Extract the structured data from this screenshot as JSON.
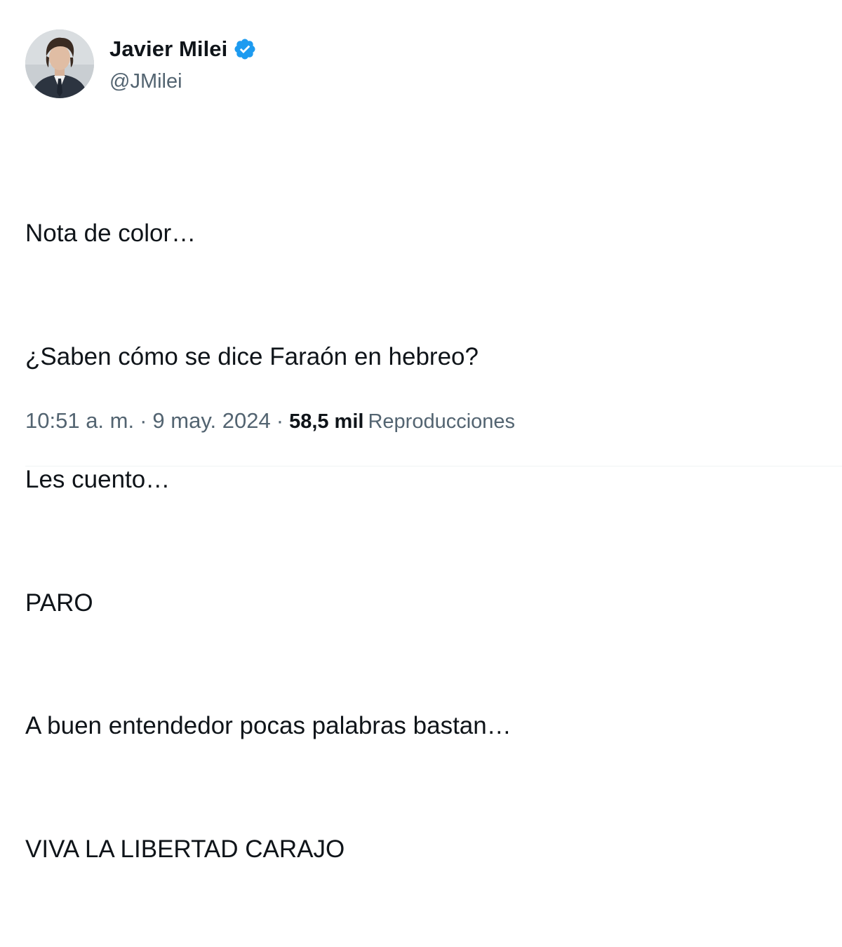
{
  "author": {
    "display_name": "Javier Milei",
    "handle": "@JMilei",
    "verified_icon": "verified-badge-icon",
    "verified_color": "#1d9bf0"
  },
  "tweet": {
    "lines": [
      "Nota de color…",
      "¿Saben cómo se dice Faraón en hebreo?",
      "Les cuento…",
      "PARO",
      "A buen entendedor pocas palabras bastan…",
      "VIVA LA LIBERTAD CARAJO"
    ]
  },
  "meta": {
    "time": "10:51 a. m.",
    "separator": "·",
    "date": "9 may. 2024",
    "views_count": "58,5 mil",
    "views_label": "Reproducciones"
  },
  "colors": {
    "text_primary": "#0f1419",
    "text_secondary": "#536471",
    "divider": "#eff3f4"
  }
}
